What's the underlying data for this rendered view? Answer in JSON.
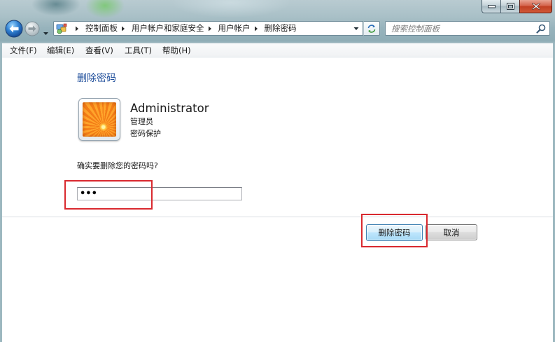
{
  "window": {
    "minimize_icon": "minimize-icon",
    "maximize_icon": "maximize-icon",
    "close_icon": "close-icon"
  },
  "nav": {
    "back_icon": "back-arrow-icon",
    "forward_icon": "forward-arrow-icon",
    "recent_pages_icon": "chevron-down-icon",
    "location_icon": "control-panel-icon",
    "breadcrumbs": [
      {
        "label": "控制面板"
      },
      {
        "label": "用户帐户和家庭安全"
      },
      {
        "label": "用户帐户"
      },
      {
        "label": "删除密码"
      }
    ],
    "refresh_icon": "refresh-icon",
    "search": {
      "placeholder": "搜索控制面板",
      "icon": "search-icon"
    }
  },
  "menu": {
    "items": [
      {
        "label": "文件(F)"
      },
      {
        "label": "编辑(E)"
      },
      {
        "label": "查看(V)"
      },
      {
        "label": "工具(T)"
      },
      {
        "label": "帮助(H)"
      }
    ]
  },
  "page": {
    "title": "删除密码",
    "user": {
      "name": "Administrator",
      "role": "管理员",
      "status": "密码保护",
      "avatar_icon": "flower-avatar-icon"
    },
    "confirm_prompt": "确实要删除您的密码吗?",
    "password": {
      "value": "•••"
    },
    "buttons": {
      "delete": "删除密码",
      "cancel": "取消"
    }
  },
  "colors": {
    "heading": "#1f4e9b",
    "highlight": "#d9292f",
    "default_button_border": "#3c7fb1"
  }
}
